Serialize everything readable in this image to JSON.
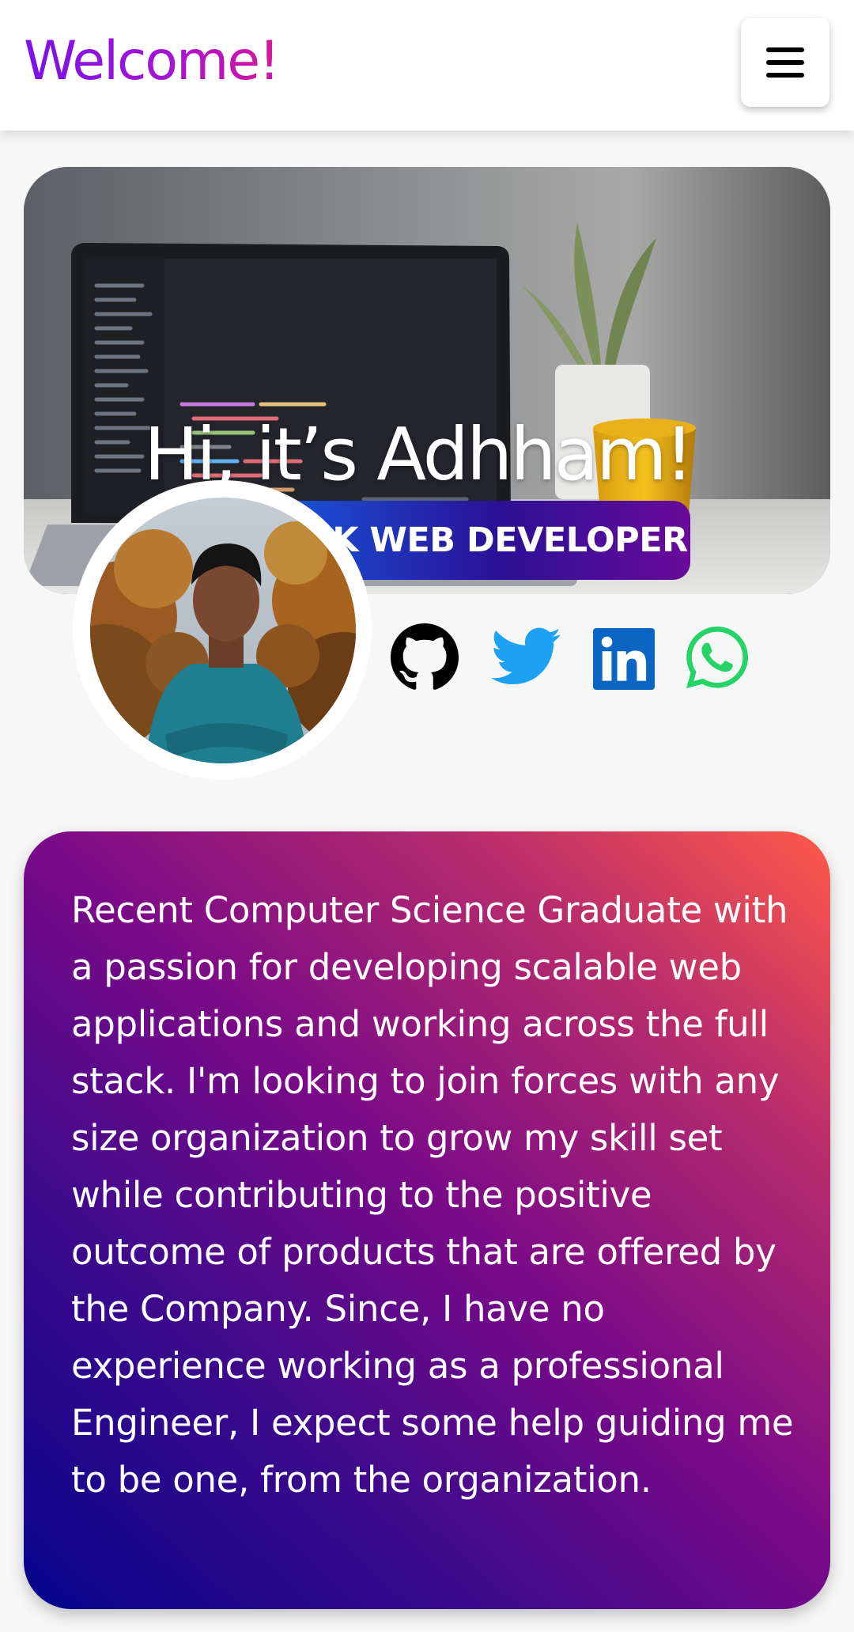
{
  "header": {
    "brand": "Welcome!",
    "menu_icon": "hamburger-menu-icon"
  },
  "hero": {
    "title": "Hi, it’s Adhham!",
    "role": "FULLSTACK WEB DEVELOPER"
  },
  "social_icons": [
    "github-icon",
    "twitter-icon",
    "linkedin-icon",
    "whatsapp-icon"
  ],
  "colors": {
    "brand_gradient": [
      "#7a12e6",
      "#d8169a"
    ],
    "badge_gradient": [
      "#0a8ff0",
      "#6a0a9a"
    ],
    "about_gradient": [
      "#06058c",
      "#ff5a48"
    ],
    "twitter": "#1da1f2",
    "linkedin": "#0a66c2",
    "whatsapp": "#25d366"
  },
  "about": {
    "text": "Recent Computer Science Graduate with a passion for developing scalable web applications and working across the full stack. I'm looking to join forces with any size organization to grow my skill set while contributing to the positive outcome of products that are offered by the Company. Since, I have no experience working as a professional Engineer, I expect some help guiding me to be one, from the organization."
  }
}
